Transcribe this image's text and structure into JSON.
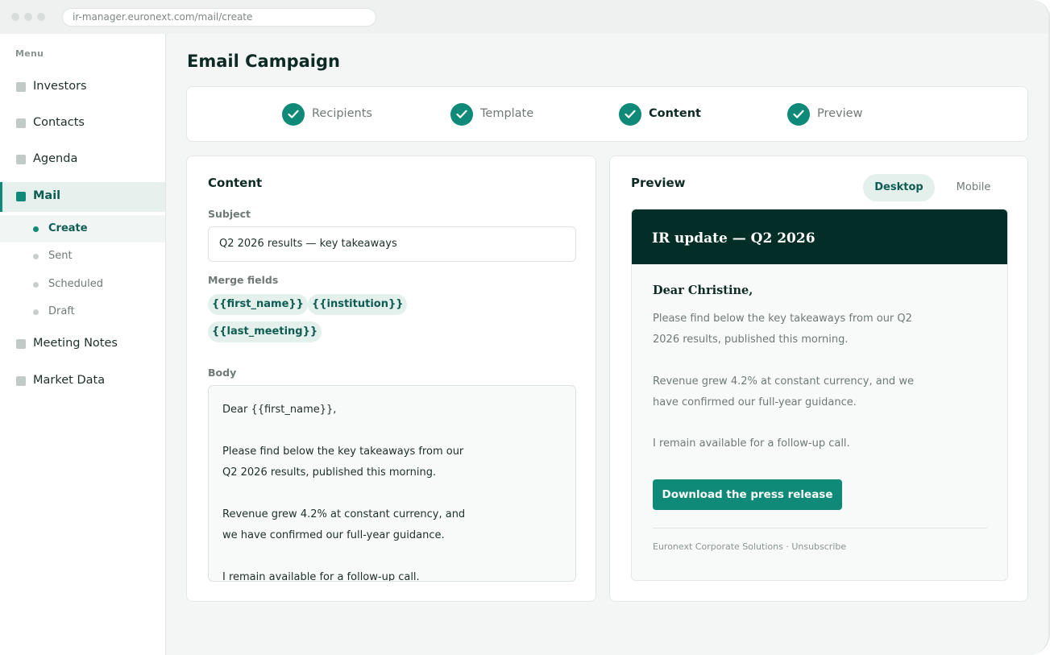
{
  "browser": {
    "url": "ir-manager.euronext.com/mail/create"
  },
  "sidebar": {
    "heading": "Menu",
    "items": [
      {
        "label": "Investors"
      },
      {
        "label": "Contacts"
      },
      {
        "label": "Agenda"
      },
      {
        "label": "Mail"
      },
      {
        "label": "Meeting Notes"
      },
      {
        "label": "Market Data"
      }
    ],
    "mail_subitems": [
      {
        "label": "Create"
      },
      {
        "label": "Sent"
      },
      {
        "label": "Scheduled"
      },
      {
        "label": "Draft"
      }
    ]
  },
  "page": {
    "title": "Email Campaign"
  },
  "stepper": {
    "steps": [
      {
        "label": "Recipients",
        "status": "complete"
      },
      {
        "label": "Template",
        "status": "complete"
      },
      {
        "label": "Content",
        "status": "complete-current"
      },
      {
        "label": "Preview",
        "status": "complete"
      }
    ]
  },
  "content": {
    "title": "Content",
    "subject_label": "Subject",
    "subject_value": "Q2 2026 results — key takeaways",
    "merge_label": "Merge fields",
    "merge_fields": [
      "{{first_name}}",
      "{{institution}}",
      "{{last_meeting}}"
    ],
    "body_label": "Body",
    "body_lines": [
      "Dear {{first_name}},",
      "Please find below the key takeaways from our",
      "Q2 2026 results, published this morning.",
      "Revenue grew 4.2% at constant currency, and",
      "we have confirmed our full-year guidance.",
      "I remain available for a follow-up call."
    ]
  },
  "preview": {
    "title": "Preview",
    "toggle": {
      "desktop": "Desktop",
      "mobile": "Mobile",
      "selected": "Desktop"
    },
    "email": {
      "header": "IR update — Q2 2026",
      "greeting": "Dear Christine,",
      "lines": [
        "Please find below the key takeaways from our Q2",
        "2026 results, published this morning.",
        "Revenue grew 4.2% at constant currency, and we",
        "have confirmed our full-year guidance.",
        "I remain available for a follow-up call."
      ],
      "cta": "Download the press release",
      "footer": "Euronext Corporate Solutions · Unsubscribe"
    }
  },
  "colors": {
    "accent": "#0f8a79",
    "email_header_bg": "#032d27",
    "chip_bg": "#e3f0ec",
    "page_bg": "#f4f6f5"
  },
  "icons": {
    "step_complete": "check-circle-icon",
    "nav": "square-icon"
  }
}
